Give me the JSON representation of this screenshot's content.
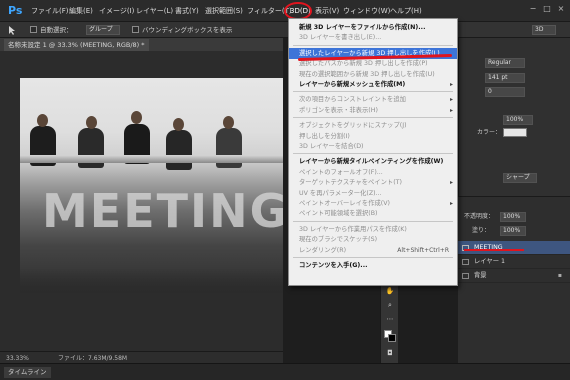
{
  "app": {
    "logo": "Ps"
  },
  "menubar": {
    "items": [
      "ファイル(F)",
      "編集(E)",
      "イメージ(I)",
      "レイヤー(L)",
      "書式(Y)",
      "選択範囲(S)",
      "フィルター(T)",
      "3D(D)",
      "表示(V)",
      "ウィンドウ(W)",
      "ヘルプ(H)"
    ],
    "window_controls": [
      "−",
      "□",
      "×"
    ]
  },
  "options_bar": {
    "auto_select_label": "自動選択：",
    "auto_select_value": "グループ",
    "bounding_box_label": "バウンディングボックスを表示",
    "mode_3d_label": "3D"
  },
  "document_tab": {
    "label": "名称未設定 1 @ 33.3% (MEETING, RGB/8) *"
  },
  "canvas": {
    "headline": "MEETING"
  },
  "status_bar": {
    "zoom": "33.33%",
    "file_info": "ファイル：7.63M/9.58M"
  },
  "timeline": {
    "label": "タイムライン"
  },
  "dropdown_3d": {
    "items": [
      {
        "label": "新規 3D レイヤーをファイルから作成(N)...",
        "state": "bold"
      },
      {
        "label": "3D レイヤーを書き出し(E)...",
        "state": "dis"
      },
      {
        "sep": true
      },
      {
        "label": "選択したレイヤーから新規 3D 押し出しを作成(L)",
        "state": "hl"
      },
      {
        "label": "選択したパスから新規 3D 押し出しを作成(P)",
        "state": "dis"
      },
      {
        "label": "現在の選択範囲から新規 3D 押し出しを作成(U)",
        "state": "dis"
      },
      {
        "label": "レイヤーから新規メッシュを作成(M)",
        "state": "bold",
        "arrow": true
      },
      {
        "sep": true
      },
      {
        "label": "次の項目からコンストレイントを追加",
        "state": "dis",
        "arrow": true
      },
      {
        "label": "ポリゴンを表示・非表示(H)",
        "state": "dis",
        "arrow": true
      },
      {
        "sep": true
      },
      {
        "label": "オブジェクトをグリッドにスナップ(J)",
        "state": "dis"
      },
      {
        "label": "押し出しを分割(I)",
        "state": "dis"
      },
      {
        "label": "3D レイヤーを結合(D)",
        "state": "dis"
      },
      {
        "sep": true
      },
      {
        "label": "レイヤーから新規タイルペインティングを作成(W)",
        "state": "bold"
      },
      {
        "label": "ペイントのフォールオフ(F)...",
        "state": "dis"
      },
      {
        "label": "ターゲットテクスチャをペイント(T)",
        "state": "dis",
        "arrow": true
      },
      {
        "label": "UV を再パラメーター化(Z)...",
        "state": "dis"
      },
      {
        "label": "ペイントオーバーレイを作成(V)",
        "state": "dis",
        "arrow": true
      },
      {
        "label": "ペイント可能領域を選択(B)",
        "state": "dis"
      },
      {
        "sep": true
      },
      {
        "label": "3D レイヤーから作業用パスを作成(K)",
        "state": "dis"
      },
      {
        "label": "現在のブラシでスケッチ(S)",
        "state": "dis"
      },
      {
        "label": "レンダリング(R)",
        "state": "dis",
        "shortcut": "Alt+Shift+Ctrl+R"
      },
      {
        "sep": true
      },
      {
        "label": "コンテンツを入手(G)...",
        "state": "bold"
      }
    ]
  },
  "character_panel": {
    "font_style": "Regular",
    "font_size": "141 pt",
    "tracking": "0",
    "scale_value": "100%",
    "color_label": "カラー：",
    "antialias": "シャープ"
  },
  "layers_panel": {
    "opacity_label": "不透明度：",
    "opacity_value": "100%",
    "fill_label": "塗り：",
    "fill_value": "100%",
    "layers": [
      {
        "name": "MEETING",
        "selected": true
      },
      {
        "name": "レイヤー 1",
        "selected": false
      },
      {
        "name": "背景",
        "selected": false
      }
    ]
  },
  "colors": {
    "highlight": "#3d74d8",
    "annotation_red": "#e0141e",
    "ps_blue": "#3ea6ff"
  }
}
